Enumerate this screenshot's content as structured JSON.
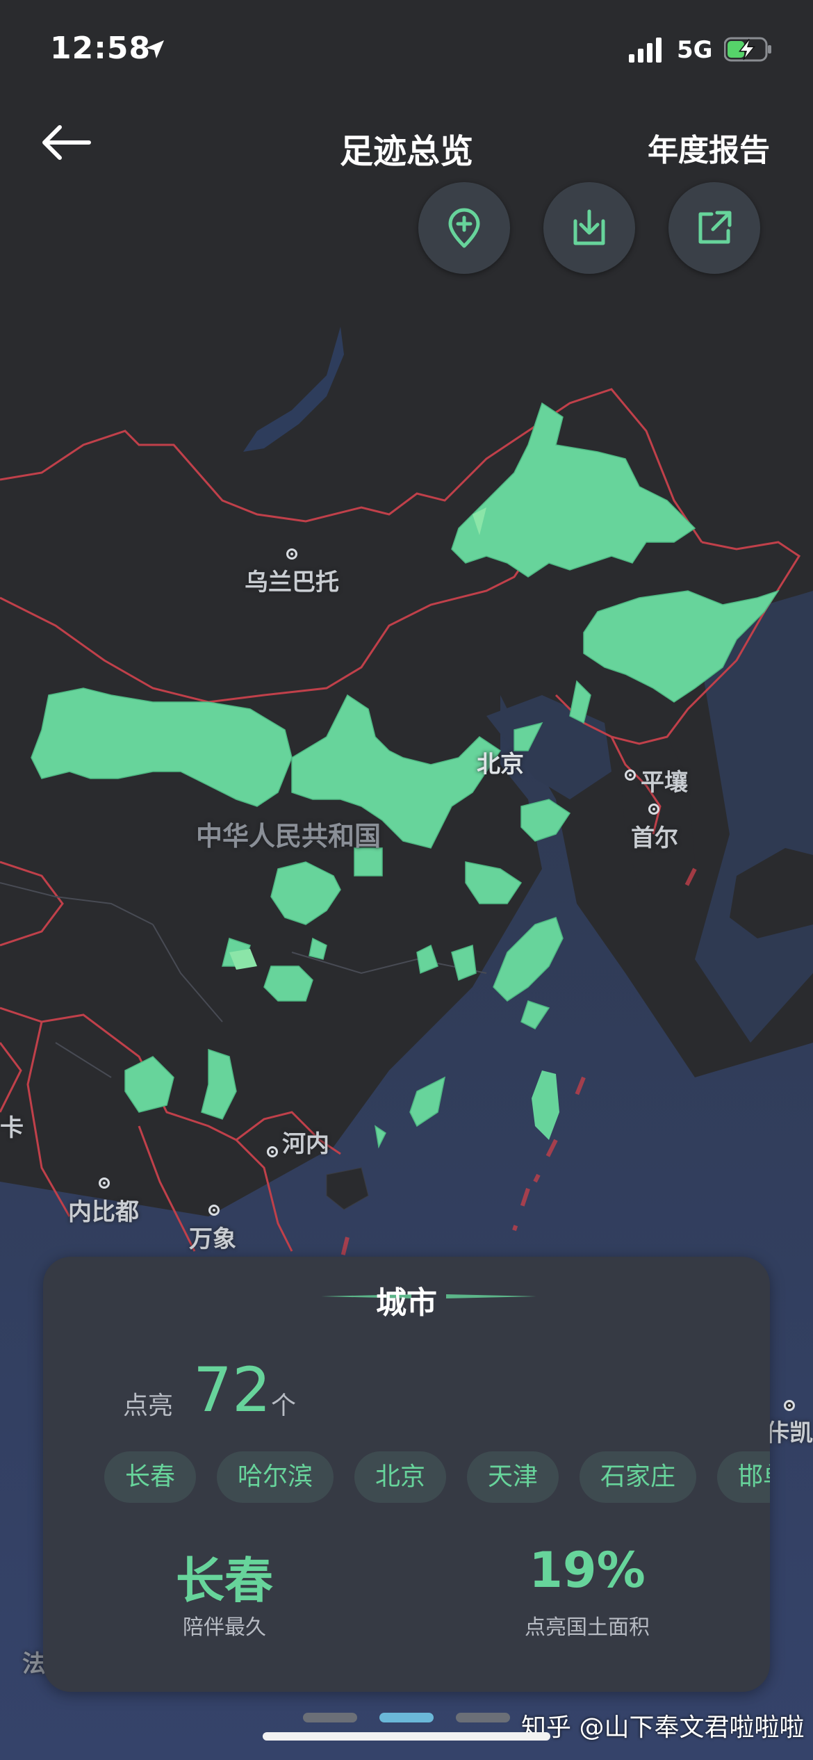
{
  "status_bar": {
    "time": "12:58",
    "network": "5G"
  },
  "header": {
    "title": "足迹总览",
    "right_action": "年度报告"
  },
  "toolbar": {
    "add_place_icon": "add-location-icon",
    "download_icon": "download-icon",
    "share_icon": "share-icon"
  },
  "map": {
    "labels": {
      "ulaanbaatar": "乌兰巴托",
      "beijing": "北京",
      "pyongyang": "平壤",
      "seoul": "首尔",
      "china": "中华人民共和国",
      "hanoi": "河内",
      "naypyidaw": "内比都",
      "vientiane": "万象",
      "edge_left": "卡",
      "edge_right": "佧凯",
      "edge_bottom_left": "法"
    },
    "colors": {
      "visited": "#67d49b",
      "border": "#c0404a",
      "sea": "#2e3a57",
      "land": "#2a2b2e"
    }
  },
  "panel": {
    "title": "城市",
    "lit_label": "点亮",
    "lit_count": "72",
    "lit_unit": "个",
    "cities": [
      "长春",
      "哈尔滨",
      "北京",
      "天津",
      "石家庄",
      "邯单"
    ],
    "longest_city": "长春",
    "longest_label": "陪伴最久",
    "area_percent": "19%",
    "area_label": "点亮国土面积"
  },
  "pager": {
    "pages": 3,
    "active": 2
  },
  "watermark": "知乎 @山下奉文君啦啦啦"
}
